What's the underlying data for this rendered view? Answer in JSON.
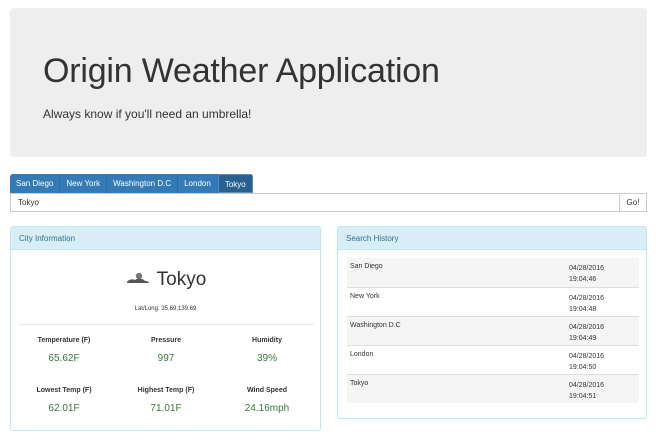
{
  "jumbotron": {
    "title": "Origin Weather Application",
    "subtitle": "Always know if you'll need an umbrella!"
  },
  "city_tabs": [
    {
      "label": "San Diego"
    },
    {
      "label": "New York"
    },
    {
      "label": "Washington D.C"
    },
    {
      "label": "London"
    },
    {
      "label": "Tokyo",
      "active": true
    }
  ],
  "search": {
    "value": "Tokyo",
    "go_label": "Go!"
  },
  "city_panel": {
    "heading": "City Information",
    "icon": "cloud-sun-icon",
    "city": "Tokyo",
    "latlong": "Lat/Long: 35.69,139.69",
    "stats": [
      {
        "label": "Temperature (F)",
        "value": "65.62F"
      },
      {
        "label": "Pressure",
        "value": "997"
      },
      {
        "label": "Humidity",
        "value": "39%"
      },
      {
        "label": "Lowest Temp (F)",
        "value": "62.01F"
      },
      {
        "label": "Highest Temp (F)",
        "value": "71.01F"
      },
      {
        "label": "Wind Speed",
        "value": "24.16mph"
      }
    ]
  },
  "history_panel": {
    "heading": "Search History",
    "rows": [
      {
        "city": "San Diego",
        "date": "04/28/2016",
        "time": "19:04:46"
      },
      {
        "city": "New York",
        "date": "04/28/2016",
        "time": "19:04:48"
      },
      {
        "city": "Washington D.C",
        "date": "04/28/2016",
        "time": "19:04:49"
      },
      {
        "city": "London",
        "date": "04/28/2016",
        "time": "19:04:50"
      },
      {
        "city": "Tokyo",
        "date": "04/28/2016",
        "time": "19:04:51"
      }
    ]
  },
  "colors": {
    "primary": "#337ab7",
    "primary_active": "#286090",
    "panel_heading_bg": "#d9edf7",
    "panel_heading_text": "#31708f",
    "value_green": "#3c763d",
    "jumbotron_bg": "#eeeeee"
  }
}
